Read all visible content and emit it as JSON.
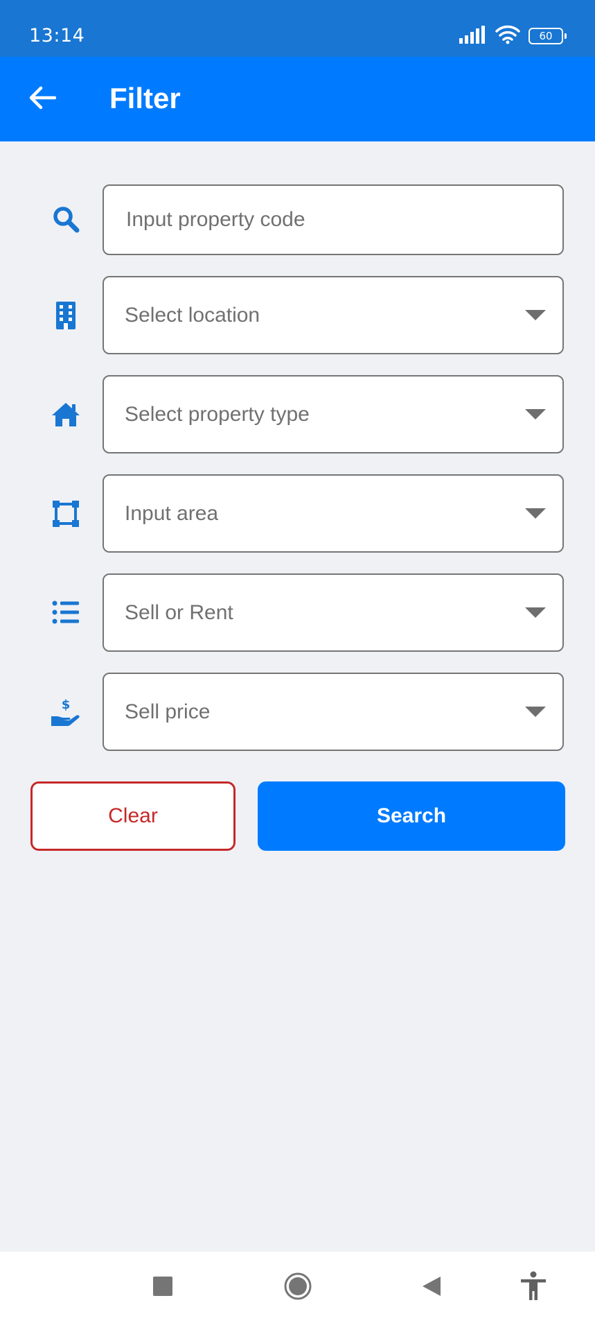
{
  "status_bar": {
    "time": "13:14",
    "battery": "60",
    "icons": [
      "signal-icon",
      "wifi-icon",
      "battery-icon"
    ]
  },
  "app_bar": {
    "title": "Filter",
    "back_icon": "arrow-left-icon"
  },
  "fields": [
    {
      "name": "property-code",
      "icon": "search-icon",
      "placeholder": "Input property code",
      "dropdown": false
    },
    {
      "name": "location",
      "icon": "building-icon",
      "placeholder": "Select location",
      "dropdown": true
    },
    {
      "name": "property-type",
      "icon": "home-icon",
      "placeholder": "Select property type",
      "dropdown": true
    },
    {
      "name": "area",
      "icon": "vector-square-icon",
      "placeholder": "Input area",
      "dropdown": true
    },
    {
      "name": "sell-or-rent",
      "icon": "list-icon",
      "placeholder": "Sell or Rent",
      "dropdown": true
    },
    {
      "name": "sell-price",
      "icon": "hand-dollar-icon",
      "placeholder": "Sell price",
      "dropdown": true
    }
  ],
  "buttons": {
    "clear_label": "Clear",
    "search_label": "Search"
  },
  "nav_bar": {
    "icons": [
      "recents-square-icon",
      "home-circle-icon",
      "back-triangle-icon",
      "accessibility-icon"
    ]
  },
  "colors": {
    "primary": "#007BFF",
    "status_bar": "#1976D2",
    "background": "#EFF1F5",
    "clear_red": "#C62828",
    "icon_blue": "#1976D2"
  }
}
